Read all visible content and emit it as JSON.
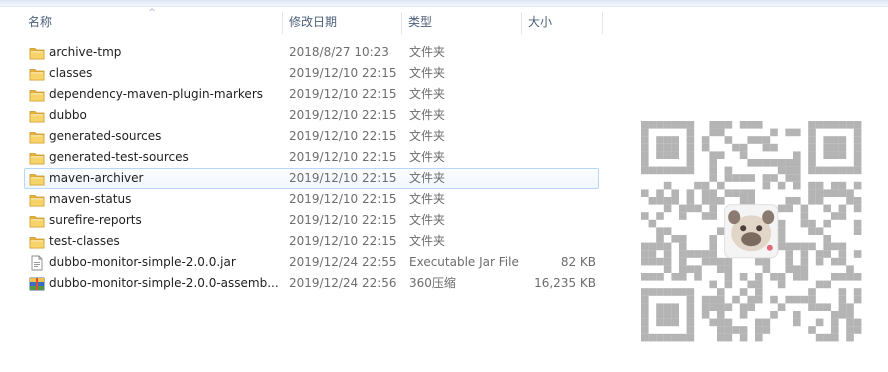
{
  "columns": {
    "name": "名称",
    "date": "修改日期",
    "type": "类型",
    "size": "大小"
  },
  "files": [
    {
      "name": "archive-tmp",
      "date": "2018/8/27 10:23",
      "type": "文件夹",
      "size": "",
      "icon": "folder-icon"
    },
    {
      "name": "classes",
      "date": "2019/12/10 22:15",
      "type": "文件夹",
      "size": "",
      "icon": "folder-icon"
    },
    {
      "name": "dependency-maven-plugin-markers",
      "date": "2019/12/10 22:15",
      "type": "文件夹",
      "size": "",
      "icon": "folder-icon"
    },
    {
      "name": "dubbo",
      "date": "2019/12/10 22:15",
      "type": "文件夹",
      "size": "",
      "icon": "folder-icon"
    },
    {
      "name": "generated-sources",
      "date": "2019/12/10 22:15",
      "type": "文件夹",
      "size": "",
      "icon": "folder-icon"
    },
    {
      "name": "generated-test-sources",
      "date": "2019/12/10 22:15",
      "type": "文件夹",
      "size": "",
      "icon": "folder-icon"
    },
    {
      "name": "maven-archiver",
      "date": "2019/12/10 22:15",
      "type": "文件夹",
      "size": "",
      "icon": "folder-icon"
    },
    {
      "name": "maven-status",
      "date": "2019/12/10 22:15",
      "type": "文件夹",
      "size": "",
      "icon": "folder-icon"
    },
    {
      "name": "surefire-reports",
      "date": "2019/12/10 22:15",
      "type": "文件夹",
      "size": "",
      "icon": "folder-icon"
    },
    {
      "name": "test-classes",
      "date": "2019/12/10 22:15",
      "type": "文件夹",
      "size": "",
      "icon": "folder-icon"
    },
    {
      "name": "dubbo-monitor-simple-2.0.0.jar",
      "date": "2019/12/24 22:55",
      "type": "Executable Jar File",
      "size": "82 KB",
      "icon": "jar-file-icon"
    },
    {
      "name": "dubbo-monitor-simple-2.0.0-assemb...",
      "date": "2019/12/24 22:56",
      "type": "360压缩",
      "size": "16,235 KB",
      "icon": "archive-file-icon"
    }
  ],
  "hovered_row": 6,
  "colors": {
    "header_text": "#4c607a",
    "hover_border": "#b8d6fb",
    "folder": "#f0c24a",
    "qr_module": "#b4b4b4"
  }
}
